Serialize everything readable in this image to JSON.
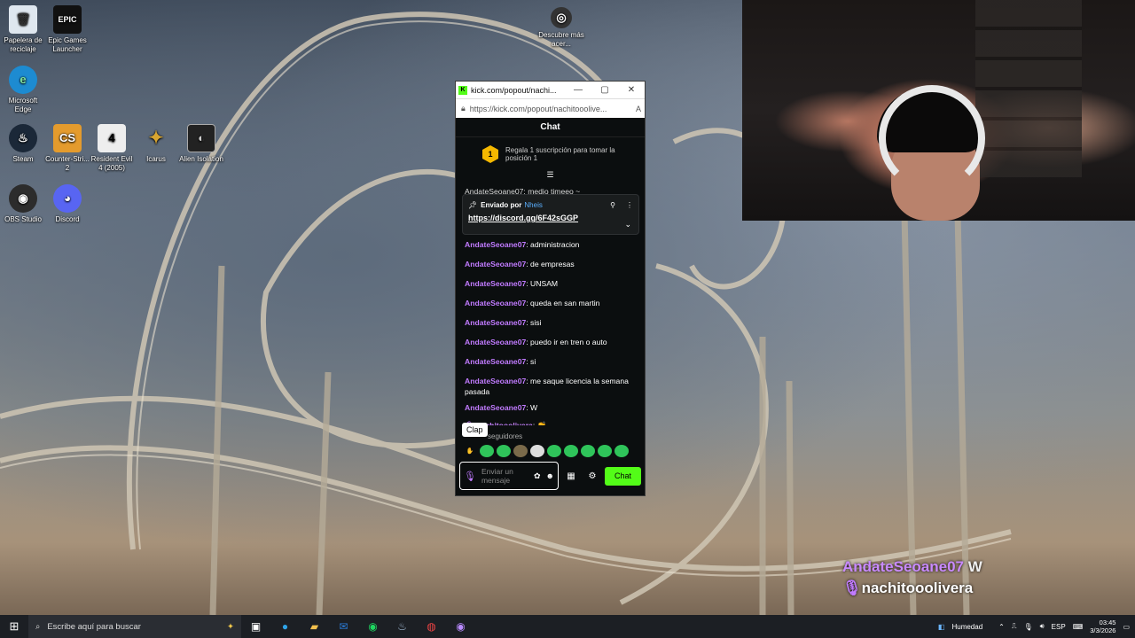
{
  "desktop": {
    "icons": [
      {
        "label": "Papelera de reciclaje",
        "glyph": "🗑",
        "color": "#dfe7ef"
      },
      {
        "label": "Epic Games Launcher",
        "glyph": "EPIC",
        "color": "#111111"
      },
      {
        "label": "Microsoft Edge",
        "glyph": "e",
        "color": "#1d8bd1"
      },
      {
        "label": "Steam",
        "glyph": "♨",
        "color": "#1b2838"
      },
      {
        "label": "Counter-Stri... 2",
        "glyph": "CS",
        "color": "#e49b2d"
      },
      {
        "label": "Resident Evil 4 (2005)",
        "glyph": "4",
        "color": "#eeeeee"
      },
      {
        "label": "Icarus",
        "glyph": "✦",
        "color": "#d8a530"
      },
      {
        "label": "Alien Isolation",
        "glyph": "◐",
        "color": "#222222"
      },
      {
        "label": "OBS Studio",
        "glyph": "◉",
        "color": "#2c2c2c"
      },
      {
        "label": "Discord",
        "glyph": "◕",
        "color": "#5865f2"
      },
      {
        "label": "Descubre más acer...",
        "glyph": "◎",
        "color": "#333333"
      }
    ]
  },
  "browser": {
    "tab_title": "kick.com/popout/nachi...",
    "url": "https://kick.com/popout/nachitooolive...",
    "chat_title": "Chat",
    "sub_banner_rank": "1",
    "sub_banner_text": "Regala 1 suscripción para tomar la posición 1",
    "partial_message": "AndateSeoane07: medio timeeo ~",
    "pinned": {
      "prefix": "Enviado por",
      "sender": "Nheis",
      "link": "https://discord.gg/6F42sGGP"
    },
    "messages": [
      {
        "user": "AndateSeoane07",
        "text": "administracion"
      },
      {
        "user": "AndateSeoane07",
        "text": "de empresas"
      },
      {
        "user": "AndateSeoane07",
        "text": "UNSAM"
      },
      {
        "user": "AndateSeoane07",
        "text": "queda en san martin"
      },
      {
        "user": "AndateSeoane07",
        "text": "sisi"
      },
      {
        "user": "AndateSeoane07",
        "text": "puedo ir en tren o auto"
      },
      {
        "user": "AndateSeoane07",
        "text": "si"
      },
      {
        "user": "AndateSeoane07",
        "text": "me saque licencia la semana pasada"
      },
      {
        "user": "AndateSeoane07",
        "text": "W"
      },
      {
        "user": "nachitooolivera",
        "text": "👏"
      }
    ],
    "tooltip": "Clap",
    "followers_note": "seguidores",
    "input_placeholder": "Enviar un mensaje",
    "send_label": "Chat"
  },
  "overlay": {
    "line1_user": "AndateSeoane07",
    "line1_text": "W",
    "line2_user": "nachitooolivera"
  },
  "taskbar": {
    "search_placeholder": "Escribe aquí para buscar",
    "weather": "Humedad",
    "lang": "ESP",
    "time": "03:45",
    "date": "3/3/2026"
  },
  "colors": {
    "kick_green": "#53fc18",
    "username_purple": "#c17bff"
  }
}
